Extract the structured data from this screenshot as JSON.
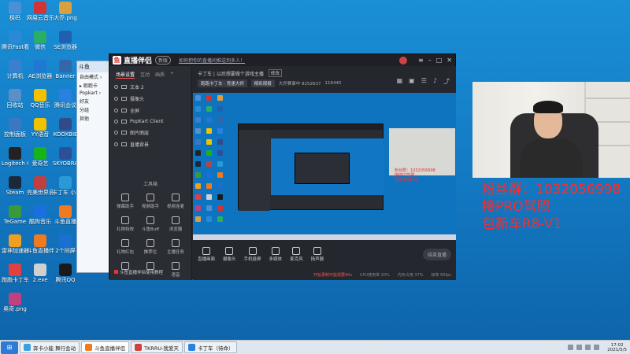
{
  "desktop": {
    "icons": [
      {
        "label": "极码",
        "icon": "app-icon",
        "color": "#4a90d9"
      },
      {
        "label": "网易云音乐",
        "icon": "netease-music-icon",
        "color": "#d33333"
      },
      {
        "label": "大乔.png",
        "icon": "image-file-icon",
        "color": "#d9a040"
      },
      {
        "label": "腾讯Fast看",
        "icon": "app-icon",
        "color": "#2a8ad6"
      },
      {
        "label": "微信",
        "icon": "wechat-icon",
        "color": "#2aae67"
      },
      {
        "label": "SE浏览器",
        "icon": "browser-icon",
        "color": "#2060b0"
      },
      {
        "label": "计算机",
        "icon": "computer-icon",
        "color": "#3b7fd0"
      },
      {
        "label": "AE浏览器",
        "icon": "browser-icon",
        "color": "#1f78d1"
      },
      {
        "label": "Banner",
        "icon": "app-icon",
        "color": "#3366aa"
      },
      {
        "label": "回收站",
        "icon": "recycle-bin-icon",
        "color": "#5a8fc8"
      },
      {
        "label": "QQ音乐",
        "icon": "qq-music-icon",
        "color": "#f2c100"
      },
      {
        "label": "腾讯会议",
        "icon": "meeting-icon",
        "color": "#2a7fe0"
      },
      {
        "label": "控制面板",
        "icon": "control-panel-icon",
        "color": "#3a78c2"
      },
      {
        "label": "YY语音",
        "icon": "yy-icon",
        "color": "#f2c100"
      },
      {
        "label": "KOOXBIE",
        "icon": "app-icon",
        "color": "#334a8a"
      },
      {
        "label": "Logitech G HUB",
        "icon": "logitech-icon",
        "color": "#222222"
      },
      {
        "label": "爱奇艺",
        "icon": "iqiyi-icon",
        "color": "#17b31a"
      },
      {
        "label": "SKYOBRA",
        "icon": "app-icon",
        "color": "#2d4f9a"
      },
      {
        "label": "Steam",
        "icon": "steam-icon",
        "color": "#1b2838"
      },
      {
        "label": "完美世界竞技平台",
        "icon": "app-icon",
        "color": "#c04040"
      },
      {
        "label": "卡丁车 小助手",
        "icon": "app-icon",
        "color": "#2a9ad6"
      },
      {
        "label": "TeGame",
        "icon": "app-icon",
        "color": "#3a9a3a"
      },
      {
        "label": "酷狗音乐",
        "icon": "kugou-icon",
        "color": "#1a6fe0"
      },
      {
        "label": "斗鱼直播",
        "icon": "douyu-icon",
        "color": "#f07a20"
      },
      {
        "label": "雷神加速器",
        "icon": "app-icon",
        "color": "#f0a020"
      },
      {
        "label": "斗鱼直播伴侣",
        "icon": "douyu-icon",
        "color": "#f07a20"
      },
      {
        "label": "2个同屏",
        "icon": "ie-icon",
        "color": "#1a70d0"
      },
      {
        "label": "跑跑卡丁车",
        "icon": "kart-icon",
        "color": "#e04040"
      },
      {
        "label": "2.exe",
        "icon": "exe-file-icon",
        "color": "#d0d0d0"
      },
      {
        "label": "腾讯QQ",
        "icon": "qq-icon",
        "color": "#1a1a1a"
      },
      {
        "label": "奥奇.png",
        "icon": "image-file-icon",
        "color": "#c04080"
      }
    ]
  },
  "qq_window": {
    "title": "斗鱼",
    "rows": [
      "自由模式 ›",
      "▸ 跑跑卡",
      "Popkart ›",
      "好友",
      "分组",
      "其他"
    ]
  },
  "app": {
    "logo": "直播伴侣",
    "version": "新版",
    "notice": "如何把你的直播间推送到多人！",
    "sidebar_tabs": [
      "场景设置",
      "互动",
      "画质",
      "+"
    ],
    "layers": [
      "文本 2",
      "摄像头",
      "全屏",
      "PopKart Client",
      "图片图层",
      "直播背景"
    ],
    "tools_title": "工具箱",
    "tools": [
      "弹幕助手",
      "视频助手",
      "视频连麦",
      "礼物特效",
      "斗鱼Buff",
      "浏览器",
      "礼物红包",
      "推荐位",
      "主播任务",
      "",
      "",
      "语音"
    ],
    "promo": "斗鱼直播伴侣使用教程",
    "room_name": "卡丁车 | 以后想要做个游戏主播",
    "room_tag": "修改",
    "room_btn1": "跑跑卡丁车 · 竞速大师",
    "room_btn2": "精彩周报",
    "room_followers": "大乔赛事中 8252637",
    "room_count": "116445",
    "controls": [
      "直播画面",
      "摄像头",
      "手机投屏",
      "多媒体",
      "麦克风",
      "扬声器"
    ],
    "golive": "结束直播",
    "status": [
      "开始录制可能需要40s",
      "CPU使用率 20%",
      "内存占用 37%",
      "帧率 60fps"
    ]
  },
  "preview": {
    "cam_caption_1": "粉丝群：1032056998",
    "cam_caption_2": "接PRO驾照",
    "cam_caption_3": "包新车R8-V1"
  },
  "overlay": {
    "line1": "粉丝群：1032056998",
    "line2": "接PRO驾照",
    "line3": "包新车R8-V1",
    "color": "#ff2a2a"
  },
  "taskbar": {
    "start": "⊞",
    "items": [
      {
        "label": "奔卡小能 舞行会动",
        "icon": "kart-icon",
        "color": "#3aa0e0"
      },
      {
        "label": "斗鱼直播伴侣",
        "icon": "douyu-icon",
        "color": "#f07a20",
        "active": true
      },
      {
        "label": "TKRRU-我爱天",
        "icon": "app-icon",
        "color": "#d04040"
      },
      {
        "label": "卡丁车（待命）",
        "icon": "app-icon",
        "color": "#2a7fe0"
      }
    ],
    "time": "17:02",
    "date": "2021/5/5"
  }
}
